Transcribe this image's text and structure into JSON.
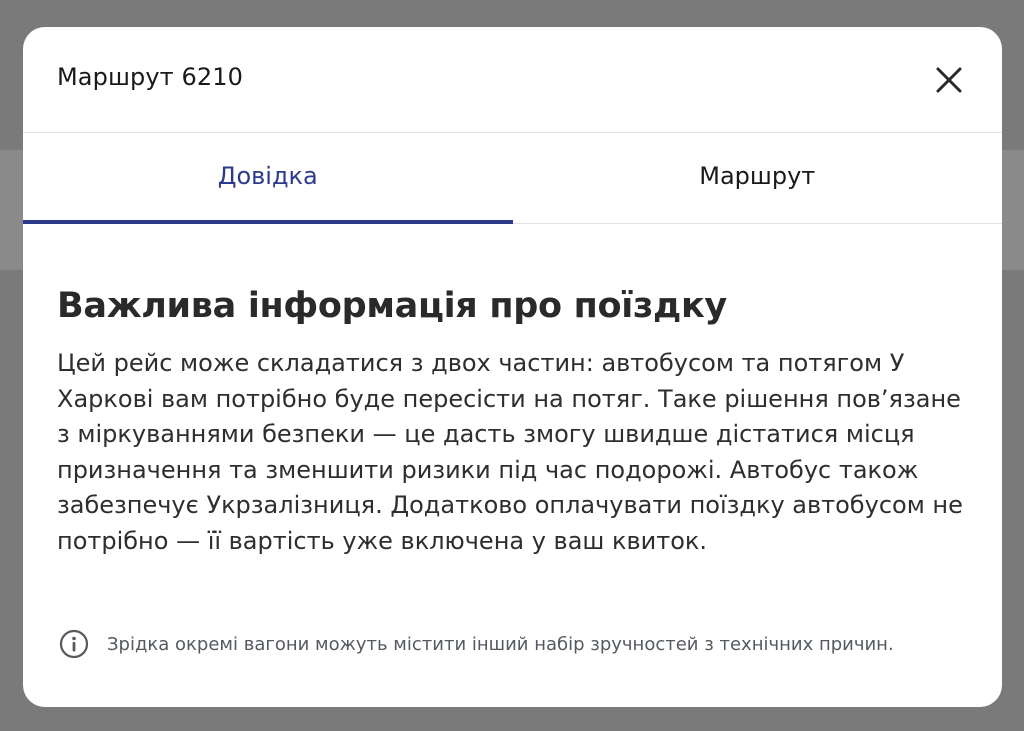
{
  "modal": {
    "title": "Маршрут 6210",
    "close_icon": "close-icon"
  },
  "tabs": [
    {
      "label": "Довідка",
      "active": true
    },
    {
      "label": "Маршрут",
      "active": false
    }
  ],
  "content": {
    "heading": "Важлива інформація про поїздку",
    "body": "Цей рейс може складатися з двох частин: автобусом та потягом У Харкові вам потрібно буде пересісти на потяг. Таке рішення пов’язане з міркуваннями безпеки — це дасть змогу швидше дістатися місця призначення та зменшити ризики під час подорожі. Автобус також забезпечує Укрзалізниця. Додатково оплачувати поїздку автобусом не потрібно — її вартість уже включена у ваш квиток.",
    "note": "Зрідка окремі вагони можуть містити інший набір зручностей з технічних причин.",
    "note_icon": "info-icon"
  },
  "colors": {
    "accent": "#2d3a8c",
    "overlay": "#7a7a7a",
    "text": "#2e2e2e",
    "note_text": "#555a60"
  }
}
